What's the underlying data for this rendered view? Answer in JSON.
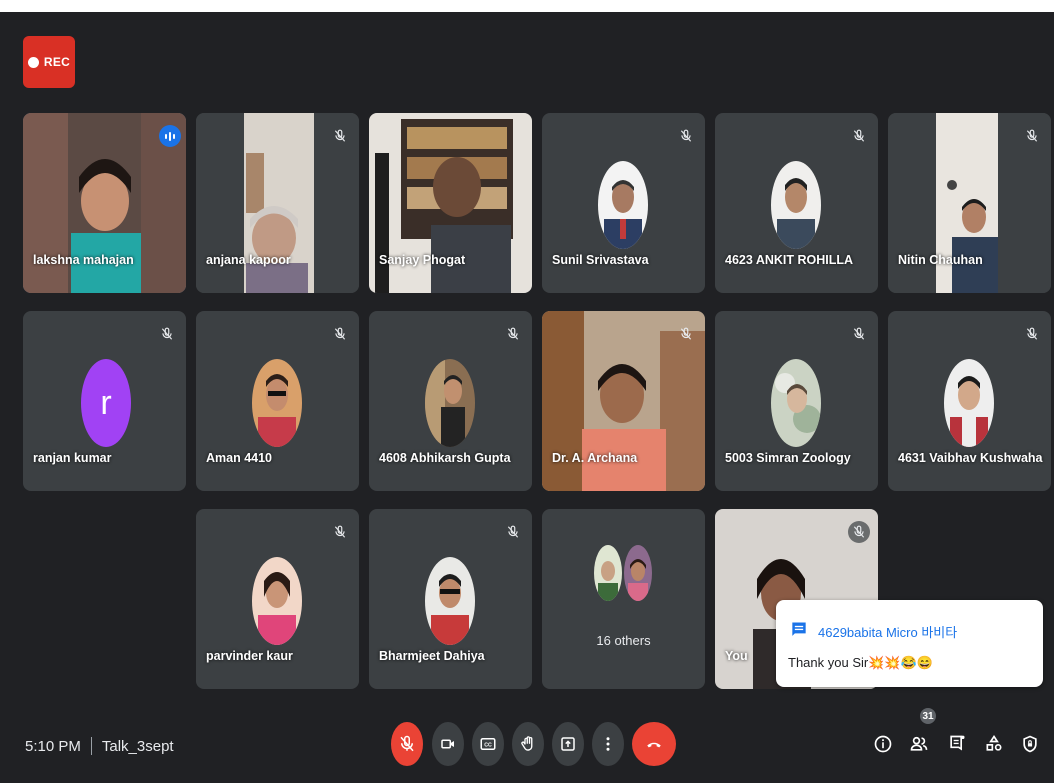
{
  "recording": {
    "label": "REC"
  },
  "participants": {
    "p1": "lakshna mahajan",
    "p2": "anjana kapoor",
    "p3": "Sanjay Phogat",
    "p4": "Sunil Srivastava",
    "p5": "4623 ANKIT ROHILLA",
    "p6": "Nitin Chauhan",
    "p7": "ranjan kumar",
    "p7_initial": "r",
    "p8": "Aman 4410",
    "p9": "4608 Abhikarsh Gupta",
    "p10": "Dr. A. Archana",
    "p11": "5003 Simran Zoology",
    "p12": "4631 Vaibhav Kushwaha",
    "p13": "parvinder kaur",
    "p14": "Bharmjeet Dahiya",
    "others": "16 others",
    "self": "You"
  },
  "meeting": {
    "time": "5:10 PM",
    "code": "Talk_3sept"
  },
  "people_count": "31",
  "chat": {
    "sender": "4629babita Micro 바비타",
    "message": "Thank you Sir💥💥😂😄"
  },
  "colors": {
    "background": "#202124",
    "tile": "#3c4043",
    "end_call": "#ea4335",
    "accent": "#1a73e8",
    "letter_avatar": "#a142f4"
  }
}
